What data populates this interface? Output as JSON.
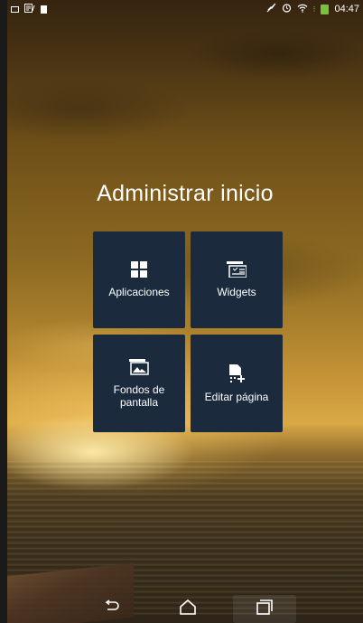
{
  "statusbar": {
    "time": "04:47",
    "left_icons": [
      "image-notification-icon",
      "screencast-notification-icon",
      "sd-card-notification-icon"
    ],
    "right_icons": [
      "mute-icon",
      "alarm-icon",
      "wifi-icon",
      "battery-charging-icon"
    ]
  },
  "page": {
    "title": "Administrar inicio"
  },
  "tiles": {
    "apps": "Aplicaciones",
    "widgets": "Widgets",
    "wallpapers": "Fondos de pantalla",
    "edit_page": "Editar página"
  },
  "navbar": {
    "buttons": [
      "back-icon",
      "home-icon",
      "recent-apps-icon"
    ]
  }
}
